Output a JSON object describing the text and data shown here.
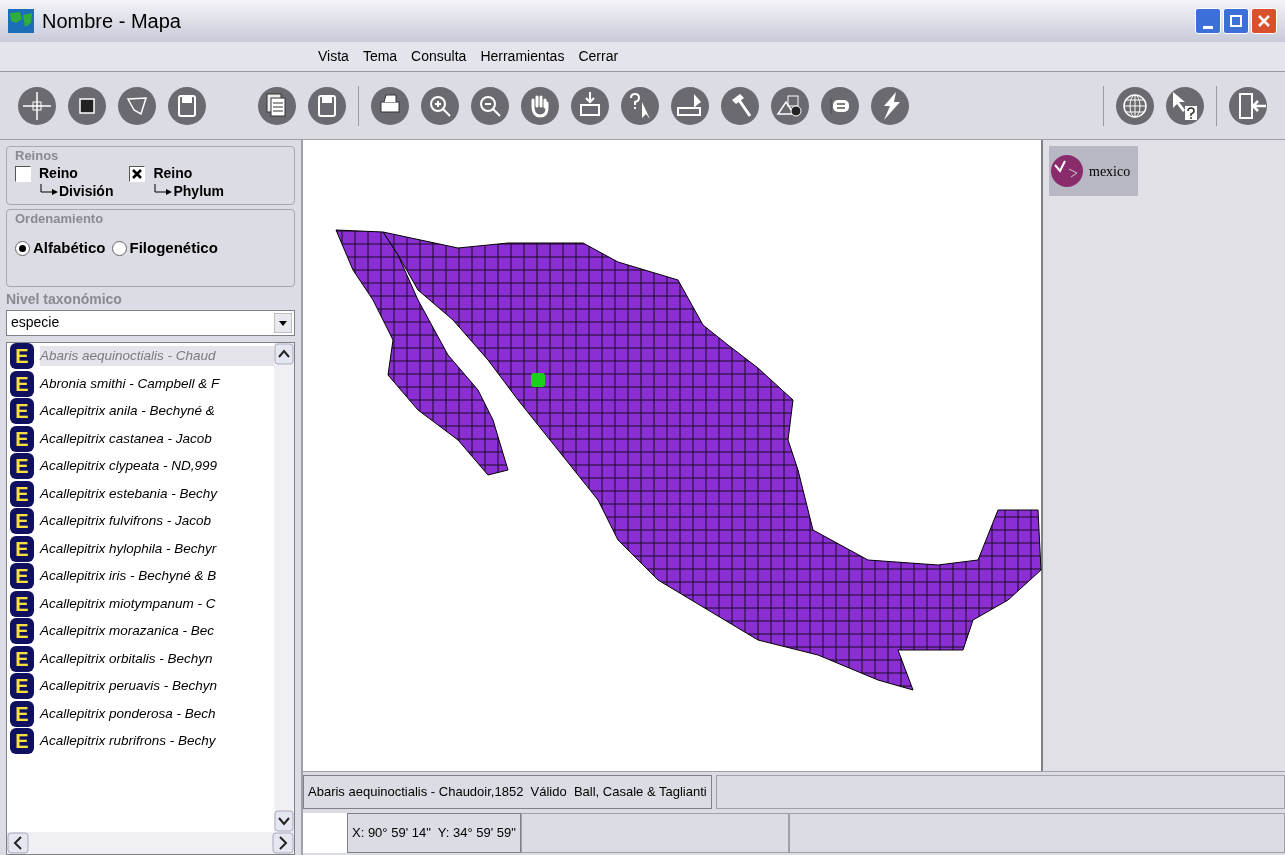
{
  "window": {
    "title": "Nombre - Mapa"
  },
  "menu": [
    "Vista",
    "Tema",
    "Consulta",
    "Herramientas",
    "Cerrar"
  ],
  "reinos": {
    "title": "Reinos",
    "options": [
      {
        "line1": "Reino",
        "line2": "División",
        "checked": false
      },
      {
        "line1": "Reino",
        "line2": "Phylum",
        "checked": true
      }
    ]
  },
  "ordenamiento": {
    "title": "Ordenamiento",
    "options": [
      {
        "label": "Alfabético",
        "selected": true
      },
      {
        "label": "Filogenético",
        "selected": false
      }
    ]
  },
  "nivel": {
    "title": "Nivel taxonómico",
    "value": "especie"
  },
  "species_list": [
    {
      "icon": "E",
      "label": "Abaris aequinoctialis - Chaud",
      "selected": true
    },
    {
      "icon": "E",
      "label": "Abronia smithi - Campbell & F",
      "selected": false
    },
    {
      "icon": "E",
      "label": "Acallepitrix anila - Bechyné &",
      "selected": false
    },
    {
      "icon": "E",
      "label": "Acallepitrix castanea - Jacob",
      "selected": false
    },
    {
      "icon": "E",
      "label": "Acallepitrix clypeata - ND,999",
      "selected": false
    },
    {
      "icon": "E",
      "label": "Acallepitrix estebania - Bechy",
      "selected": false
    },
    {
      "icon": "E",
      "label": "Acallepitrix fulvifrons - Jacob",
      "selected": false
    },
    {
      "icon": "E",
      "label": "Acallepitrix hylophila - Bechyr",
      "selected": false
    },
    {
      "icon": "E",
      "label": "Acallepitrix iris - Bechyné & B",
      "selected": false
    },
    {
      "icon": "E",
      "label": "Acallepitrix miotympanum - C",
      "selected": false
    },
    {
      "icon": "E",
      "label": "Acallepitrix morazanica - Bec",
      "selected": false
    },
    {
      "icon": "E",
      "label": "Acallepitrix orbitalis - Bechyn",
      "selected": false
    },
    {
      "icon": "E",
      "label": "Acallepitrix peruavis - Bechyn",
      "selected": false
    },
    {
      "icon": "E",
      "label": "Acallepitrix ponderosa - Bech",
      "selected": false
    },
    {
      "icon": "E",
      "label": "Acallepitrix rubrifrons - Bechy",
      "selected": false
    }
  ],
  "legend": [
    {
      "label": "mexico"
    }
  ],
  "status_bar": {
    "species": "Abaris aequinoctialis - Chaudoir,1852  Válido  Ball, Casale & Taglianti",
    "coordinates": "X: 90° 59' 14\"  Y: 34° 59' 59\""
  }
}
